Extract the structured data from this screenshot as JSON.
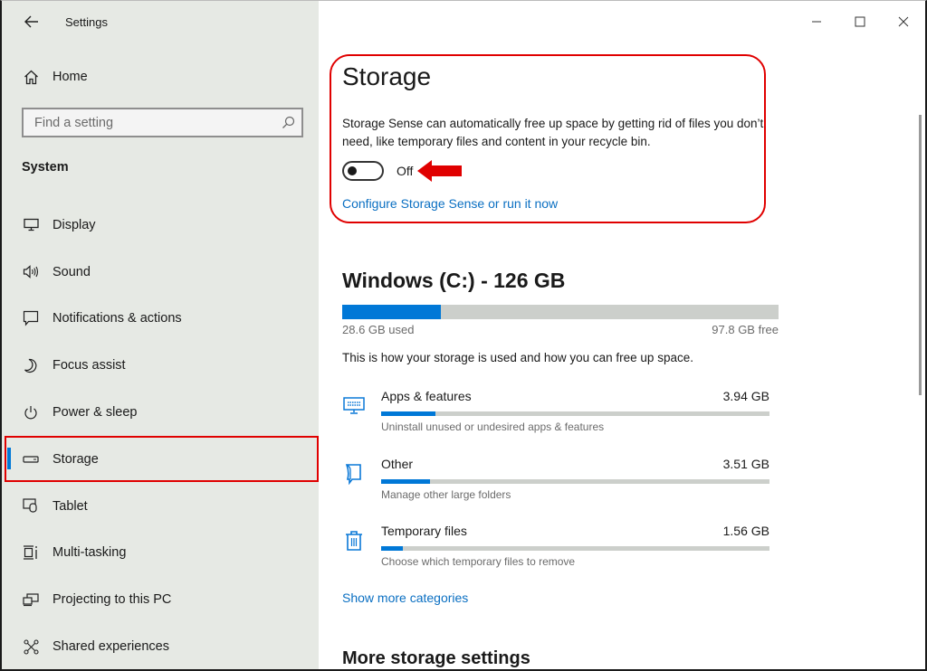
{
  "window": {
    "title": "Settings",
    "controls": {
      "minimize_icon": "minimize-icon",
      "maximize_icon": "maximize-icon",
      "close_icon": "close-icon"
    }
  },
  "sidebar": {
    "back_icon": "back-arrow-icon",
    "home": {
      "label": "Home",
      "icon": "home-icon"
    },
    "search": {
      "placeholder": "Find a setting",
      "value": "",
      "icon": "search-icon"
    },
    "section_label": "System",
    "items": [
      {
        "label": "Display",
        "icon": "display-icon",
        "selected": false
      },
      {
        "label": "Sound",
        "icon": "sound-icon",
        "selected": false
      },
      {
        "label": "Notifications & actions",
        "icon": "notifications-icon",
        "selected": false
      },
      {
        "label": "Focus assist",
        "icon": "moon-icon",
        "selected": false
      },
      {
        "label": "Power & sleep",
        "icon": "power-icon",
        "selected": false
      },
      {
        "label": "Storage",
        "icon": "storage-drive-icon",
        "selected": true
      },
      {
        "label": "Tablet",
        "icon": "tablet-icon",
        "selected": false
      },
      {
        "label": "Multi-tasking",
        "icon": "multitasking-icon",
        "selected": false
      },
      {
        "label": "Projecting to this PC",
        "icon": "projecting-icon",
        "selected": false
      },
      {
        "label": "Shared experiences",
        "icon": "shared-experiences-icon",
        "selected": false
      }
    ]
  },
  "main": {
    "title": "Storage",
    "storage_sense": {
      "description": "Storage Sense can automatically free up space by getting rid of files you don’t need, like temporary files and content in your recycle bin.",
      "toggle_state": "Off",
      "toggle_on": false,
      "configure_link": "Configure Storage Sense or run it now"
    },
    "drive": {
      "title": "Windows (C:) - 126 GB",
      "used_label": "28.6 GB used",
      "free_label": "97.8 GB free",
      "used_fraction": 0.227,
      "description": "This is how your storage is used and how you can free up space."
    },
    "categories": [
      {
        "name": "Apps & features",
        "size": "3.94 GB",
        "subtitle": "Uninstall unused or undesired apps & features",
        "icon": "apps-monitor-icon",
        "fill_fraction": 0.14
      },
      {
        "name": "Other",
        "size": "3.51 GB",
        "subtitle": "Manage other large folders",
        "icon": "folder-other-icon",
        "fill_fraction": 0.125
      },
      {
        "name": "Temporary files",
        "size": "1.56 GB",
        "subtitle": "Choose which temporary files to remove",
        "icon": "trash-icon",
        "fill_fraction": 0.055
      }
    ],
    "show_more_link": "Show more categories",
    "more_settings_title": "More storage settings"
  },
  "annotations": {
    "highlight_color": "#e00000",
    "accent_color": "#0078d7"
  }
}
